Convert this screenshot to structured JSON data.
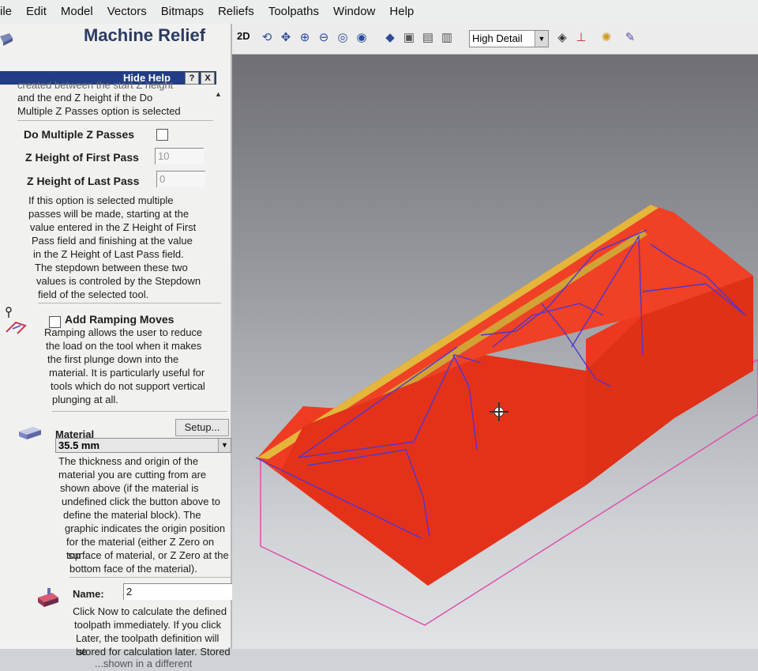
{
  "menu": [
    "ile",
    "Edit",
    "Model",
    "Vectors",
    "Bitmaps",
    "Reliefs",
    "Toolpaths",
    "Window",
    "Help"
  ],
  "panel": {
    "title": "Machine Relief",
    "help_bar": {
      "label": "Hide Help",
      "help_button": "?",
      "close_button": "X"
    },
    "intro_text": [
      "created between the start Z height",
      "and the end Z height if the Do",
      "Multiple Z Passes option is selected"
    ],
    "do_multiple_passes": {
      "label": "Do Multiple Z Passes",
      "checked": false
    },
    "z_first": {
      "label": "Z Height of First Pass",
      "value": "10"
    },
    "z_last": {
      "label": "Z Height of Last Pass",
      "value": "0"
    },
    "multi_help": [
      "If this option is selected multiple",
      "passes will be made, starting at the",
      "value entered in the Z Height of First",
      "Pass field and finishing at the value",
      "in the Z Height of Last Pass field.",
      "The stepdown between these two",
      "values is controled by the Stepdown",
      "field of the selected tool."
    ],
    "ramping": {
      "label": "Add Ramping Moves",
      "checked": false
    },
    "ramping_help": [
      "Ramping allows the user to reduce",
      "the load on the tool when it makes",
      "the first plunge down into the",
      "material. It is particularly useful for",
      "tools which do not support vertical",
      "plunging at all."
    ],
    "material": {
      "label": "Material",
      "setup_button": "Setup...",
      "value": "35.5 mm"
    },
    "material_help": [
      "The thickness and origin of the",
      "material you are cutting from are",
      "shown above (if the material is",
      "undefined click the button above to",
      "define the material block). The",
      "graphic indicates the origin position",
      "for the material (either Z Zero on top",
      "surface of material, or Z Zero at the",
      "bottom face of the material)."
    ],
    "name": {
      "label": "Name:",
      "value": "2"
    },
    "name_help": [
      "Click Now to calculate the defined",
      "toolpath immediately. If you click",
      "Later, the toolpath definition will be",
      "stored for calculation later. Stored",
      "...shown in a different"
    ]
  },
  "toolbar": {
    "mode_2d": "2D",
    "detail": "High Detail",
    "icons": [
      "rotate-view-icon",
      "pan-view-icon",
      "zoom-in-icon",
      "zoom-out-icon",
      "zoom-window-icon",
      "zoom-all-icon",
      "iso-view-icon",
      "top-view-icon",
      "front-view-icon",
      "side-view-icon",
      "material-icon",
      "axis-icon",
      "lighting-icon",
      "settings-icon"
    ]
  },
  "colors": {
    "relief": "#f03a1f",
    "relief_dark": "#d52d14",
    "toolpath": "#4d36d3",
    "rim": "#e5b53a",
    "material_outline": "#e04fae",
    "title_color": "#2a3a63",
    "help_bar": "#223d86"
  }
}
